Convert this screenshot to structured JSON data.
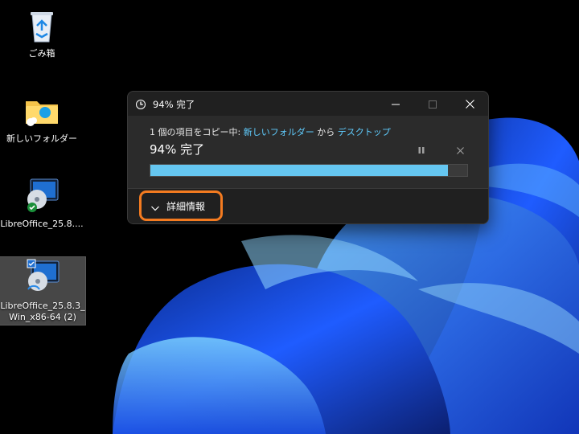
{
  "desktop": {
    "icons": [
      {
        "label": "ごみ箱",
        "icon": "recycle-bin-icon"
      },
      {
        "label": "新しいフォルダー",
        "icon": "folder-icon"
      },
      {
        "label": "LibreOffice_25.8....",
        "icon": "installer-disc-icon"
      },
      {
        "label_line1": "LibreOffice_25.8.3_",
        "label_line2": "Win_x86-64 (2)",
        "icon": "installer-disc-icon"
      }
    ]
  },
  "dialog": {
    "title": "94% 完了",
    "copy_prefix": "1 個の項目をコピー中: ",
    "source": "新しいフォルダー",
    "connector": " から ",
    "destination": "デスクトップ",
    "progress_label": "94% 完了",
    "progress_percent": 94,
    "details_label": "詳細情報"
  },
  "colors": {
    "accent_link": "#60cdff",
    "progress_fill": "#65c6f0",
    "highlight_ring": "#f47b20"
  }
}
